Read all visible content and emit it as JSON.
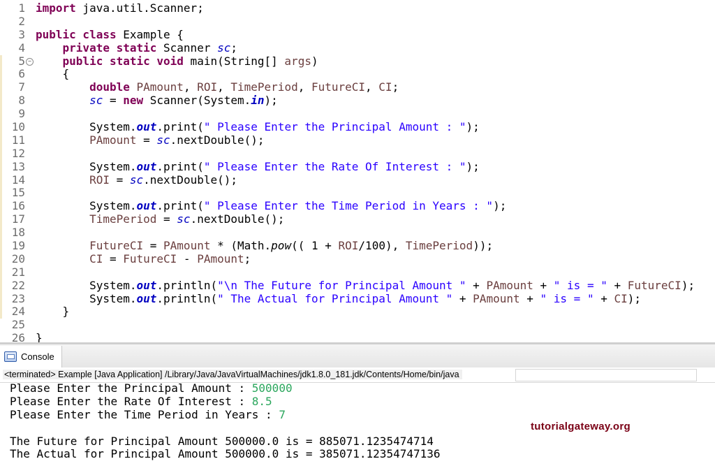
{
  "editor": {
    "lines": [
      {
        "n": "1",
        "tokens": [
          [
            "kw",
            "import"
          ],
          [
            "plain",
            " java.util.Scanner;"
          ]
        ]
      },
      {
        "n": "2",
        "tokens": []
      },
      {
        "n": "3",
        "tokens": [
          [
            "kw",
            "public class"
          ],
          [
            "plain",
            " Example {"
          ]
        ]
      },
      {
        "n": "4",
        "tokens": [
          [
            "plain",
            "    "
          ],
          [
            "kw",
            "private static"
          ],
          [
            "plain",
            " Scanner "
          ],
          [
            "fld",
            "sc"
          ],
          [
            "plain",
            ";"
          ]
        ]
      },
      {
        "n": "5",
        "fold": true,
        "tokens": [
          [
            "plain",
            "    "
          ],
          [
            "kw",
            "public static void"
          ],
          [
            "plain",
            " main(String[] "
          ],
          [
            "var",
            "args"
          ],
          [
            "plain",
            ")"
          ]
        ]
      },
      {
        "n": "6",
        "tokens": [
          [
            "plain",
            "    {"
          ]
        ]
      },
      {
        "n": "7",
        "tokens": [
          [
            "plain",
            "        "
          ],
          [
            "kw",
            "double"
          ],
          [
            "plain",
            " "
          ],
          [
            "var",
            "PAmount"
          ],
          [
            "plain",
            ", "
          ],
          [
            "var",
            "ROI"
          ],
          [
            "plain",
            ", "
          ],
          [
            "var",
            "TimePeriod"
          ],
          [
            "plain",
            ", "
          ],
          [
            "var",
            "FutureCI"
          ],
          [
            "plain",
            ", "
          ],
          [
            "var",
            "CI"
          ],
          [
            "plain",
            ";"
          ]
        ]
      },
      {
        "n": "8",
        "tokens": [
          [
            "plain",
            "        "
          ],
          [
            "fld",
            "sc"
          ],
          [
            "plain",
            " = "
          ],
          [
            "kw",
            "new"
          ],
          [
            "plain",
            " Scanner(System."
          ],
          [
            "sfld",
            "in"
          ],
          [
            "plain",
            ");"
          ]
        ]
      },
      {
        "n": "9",
        "tokens": []
      },
      {
        "n": "10",
        "tokens": [
          [
            "plain",
            "        System."
          ],
          [
            "sfld",
            "out"
          ],
          [
            "plain",
            ".print("
          ],
          [
            "str",
            "\" Please Enter the Principal Amount : \""
          ],
          [
            "plain",
            ");"
          ]
        ]
      },
      {
        "n": "11",
        "tokens": [
          [
            "plain",
            "        "
          ],
          [
            "var",
            "PAmount"
          ],
          [
            "plain",
            " = "
          ],
          [
            "fld",
            "sc"
          ],
          [
            "plain",
            ".nextDouble();"
          ]
        ]
      },
      {
        "n": "12",
        "tokens": []
      },
      {
        "n": "13",
        "tokens": [
          [
            "plain",
            "        System."
          ],
          [
            "sfld",
            "out"
          ],
          [
            "plain",
            ".print("
          ],
          [
            "str",
            "\" Please Enter the Rate Of Interest : \""
          ],
          [
            "plain",
            ");"
          ]
        ]
      },
      {
        "n": "14",
        "tokens": [
          [
            "plain",
            "        "
          ],
          [
            "var",
            "ROI"
          ],
          [
            "plain",
            " = "
          ],
          [
            "fld",
            "sc"
          ],
          [
            "plain",
            ".nextDouble();"
          ]
        ]
      },
      {
        "n": "15",
        "tokens": []
      },
      {
        "n": "16",
        "tokens": [
          [
            "plain",
            "        System."
          ],
          [
            "sfld",
            "out"
          ],
          [
            "plain",
            ".print("
          ],
          [
            "str",
            "\" Please Enter the Time Period in Years : \""
          ],
          [
            "plain",
            ");"
          ]
        ]
      },
      {
        "n": "17",
        "tokens": [
          [
            "plain",
            "        "
          ],
          [
            "var",
            "TimePeriod"
          ],
          [
            "plain",
            " = "
          ],
          [
            "fld",
            "sc"
          ],
          [
            "plain",
            ".nextDouble();"
          ]
        ]
      },
      {
        "n": "18",
        "tokens": []
      },
      {
        "n": "19",
        "tokens": [
          [
            "plain",
            "        "
          ],
          [
            "var",
            "FutureCI"
          ],
          [
            "plain",
            " = "
          ],
          [
            "var",
            "PAmount"
          ],
          [
            "plain",
            " * (Math."
          ],
          [
            "ital",
            "pow"
          ],
          [
            "plain",
            "(( 1 + "
          ],
          [
            "var",
            "ROI"
          ],
          [
            "plain",
            "/100), "
          ],
          [
            "var",
            "TimePeriod"
          ],
          [
            "plain",
            "));"
          ]
        ]
      },
      {
        "n": "20",
        "tokens": [
          [
            "plain",
            "        "
          ],
          [
            "var",
            "CI"
          ],
          [
            "plain",
            " = "
          ],
          [
            "var",
            "FutureCI"
          ],
          [
            "plain",
            " - "
          ],
          [
            "var",
            "PAmount"
          ],
          [
            "plain",
            ";"
          ]
        ]
      },
      {
        "n": "21",
        "tokens": []
      },
      {
        "n": "22",
        "tokens": [
          [
            "plain",
            "        System."
          ],
          [
            "sfld",
            "out"
          ],
          [
            "plain",
            ".println("
          ],
          [
            "str",
            "\"\\n The Future for Principal Amount \""
          ],
          [
            "plain",
            " + "
          ],
          [
            "var",
            "PAmount"
          ],
          [
            "plain",
            " + "
          ],
          [
            "str",
            "\" is = \""
          ],
          [
            "plain",
            " + "
          ],
          [
            "var",
            "FutureCI"
          ],
          [
            "plain",
            ");"
          ]
        ]
      },
      {
        "n": "23",
        "tokens": [
          [
            "plain",
            "        System."
          ],
          [
            "sfld",
            "out"
          ],
          [
            "plain",
            ".println("
          ],
          [
            "str",
            "\" The Actual for Principal Amount \""
          ],
          [
            "plain",
            " + "
          ],
          [
            "var",
            "PAmount"
          ],
          [
            "plain",
            " + "
          ],
          [
            "str",
            "\" is = \""
          ],
          [
            "plain",
            " + "
          ],
          [
            "var",
            "CI"
          ],
          [
            "plain",
            ");"
          ]
        ]
      },
      {
        "n": "24",
        "tokens": [
          [
            "plain",
            "    }"
          ]
        ]
      },
      {
        "n": "25",
        "tokens": []
      },
      {
        "n": "26",
        "tokens": [
          [
            "plain",
            "}"
          ]
        ]
      }
    ],
    "colors": {
      "keyword": "#7f0055",
      "string": "#2a00ff",
      "field": "#0000c0",
      "local_variable": "#6a3e3e",
      "line_number": "#6e6e6e"
    }
  },
  "console": {
    "tab_label": "Console",
    "icon": "console-icon",
    "launch_text": "<terminated> Example [Java Application] /Library/Java/JavaVirtualMachines/jdk1.8.0_181.jdk/Contents/Home/bin/java",
    "output": [
      {
        "text": "Please Enter the Principal Amount : ",
        "input": "500000"
      },
      {
        "text": "Please Enter the Rate Of Interest : ",
        "input": "8.5"
      },
      {
        "text": "Please Enter the Time Period in Years : ",
        "input": "7"
      },
      {
        "text": "",
        "input": ""
      },
      {
        "text": "The Future for Principal Amount 500000.0 is = 885071.1235474714",
        "input": ""
      },
      {
        "text": "The Actual for Principal Amount 500000.0 is = 385071.12354747136",
        "input": ""
      }
    ],
    "input_color": "#2aa65c"
  },
  "watermark": "tutorialgateway.org"
}
